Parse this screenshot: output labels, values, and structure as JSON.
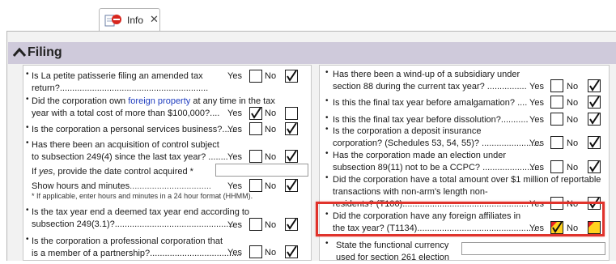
{
  "tab": {
    "title": "Info",
    "close": "✕",
    "icon": "info-blocked-icon"
  },
  "section": {
    "title": "Filing",
    "collapse_icon": "chevron-up-icon"
  },
  "checks": {
    "checked_color": "#111111",
    "flag_yellow": "#ffd21e",
    "flag_red": "#e82222",
    "highlight": "#e0332c"
  },
  "left": {
    "q1": {
      "lines": [
        "Is La petite patisserie filing an amended tax",
        "return?............................................................"
      ],
      "yes": "Yes",
      "no": "No",
      "yes_checked": false,
      "no_checked": true
    },
    "q2": {
      "pre": "Did the corporation own ",
      "link": "foreign property",
      "post": " at any time in the tax",
      "line2": "year with a total cost of more than $100,000?....",
      "yes": "Yes",
      "no": "No",
      "yes_checked": true,
      "no_checked": false
    },
    "q3": {
      "lines": [
        "Is the corporation a personal services business?......"
      ],
      "yes": "Yes",
      "no": "No",
      "yes_checked": false,
      "no_checked": true
    },
    "q4": {
      "lines": [
        "Has there been an acquisition of control subject",
        "to subsection 249(4) since the last tax year? ........"
      ],
      "yes": "Yes",
      "no": "No",
      "yes_checked": false,
      "no_checked": true
    },
    "q4_date": {
      "pre": "If ",
      "emph": "yes",
      "post": ", provide the date control acquired *",
      "value": ""
    },
    "q4_hours": {
      "label": "Show hours and minutes",
      "dots": ".................................",
      "yes": "Yes",
      "no": "No",
      "yes_checked": false,
      "no_checked": true,
      "note": "* If applicable, enter hours and minutes in a 24 hour format (HHMM)."
    },
    "q5": {
      "lines": [
        "Is the tax year end a deemed tax year end according to",
        "subsection 249(3.1)?................................................"
      ],
      "yes": "Yes",
      "no": "No",
      "yes_checked": false,
      "no_checked": true
    },
    "q6": {
      "lines": [
        "Is the corporation a professional corporation that",
        "is a member of a partnership?....................................."
      ],
      "yes": "Yes",
      "no": "No",
      "yes_checked": false,
      "no_checked": true
    }
  },
  "right": {
    "q1": {
      "lines": [
        "Has there been a wind-up of a subsidiary under",
        "section 88 during the current tax year? ................"
      ],
      "yes": "Yes",
      "no": "No",
      "yes_checked": false,
      "no_checked": true
    },
    "q2": {
      "lines": [
        "Is this the final tax year before amalgamation? ...."
      ],
      "yes": "Yes",
      "no": "No",
      "yes_checked": false,
      "no_checked": true
    },
    "q3": {
      "lines": [
        "Is this the final tax year before dissolution?..........."
      ],
      "yes": "Yes",
      "no": "No",
      "yes_checked": false,
      "no_checked": true
    },
    "q4": {
      "lines": [
        "Is the corporation a deposit insurance",
        "corporation? (Schedules 53, 54, 55)? ........................"
      ],
      "yes": "Yes",
      "no": "No",
      "yes_checked": false,
      "no_checked": true
    },
    "q5": {
      "lines": [
        "Has the corporation made an election under",
        "subsection 89(11) not to be a CCPC? ........................"
      ],
      "yes": "Yes",
      "no": "No",
      "yes_checked": false,
      "no_checked": true
    },
    "q6": {
      "lines": [
        "Did the corporation have a total amount over $1 million of reportable",
        "transactions with non-arm's length non-",
        "residents? (T106)..................................................."
      ],
      "yes": "Yes",
      "no": "No",
      "yes_checked": false,
      "no_checked": true
    },
    "q7": {
      "lines": [
        "Did the corporation have any foreign affiliates in",
        "the tax year? (T1134)................................................"
      ],
      "yes": "Yes",
      "no": "No",
      "yes_checked": true,
      "no_checked": false
    },
    "q8": {
      "lines": [
        "State the functional currency",
        "used for section 261 election"
      ],
      "value": ""
    }
  }
}
